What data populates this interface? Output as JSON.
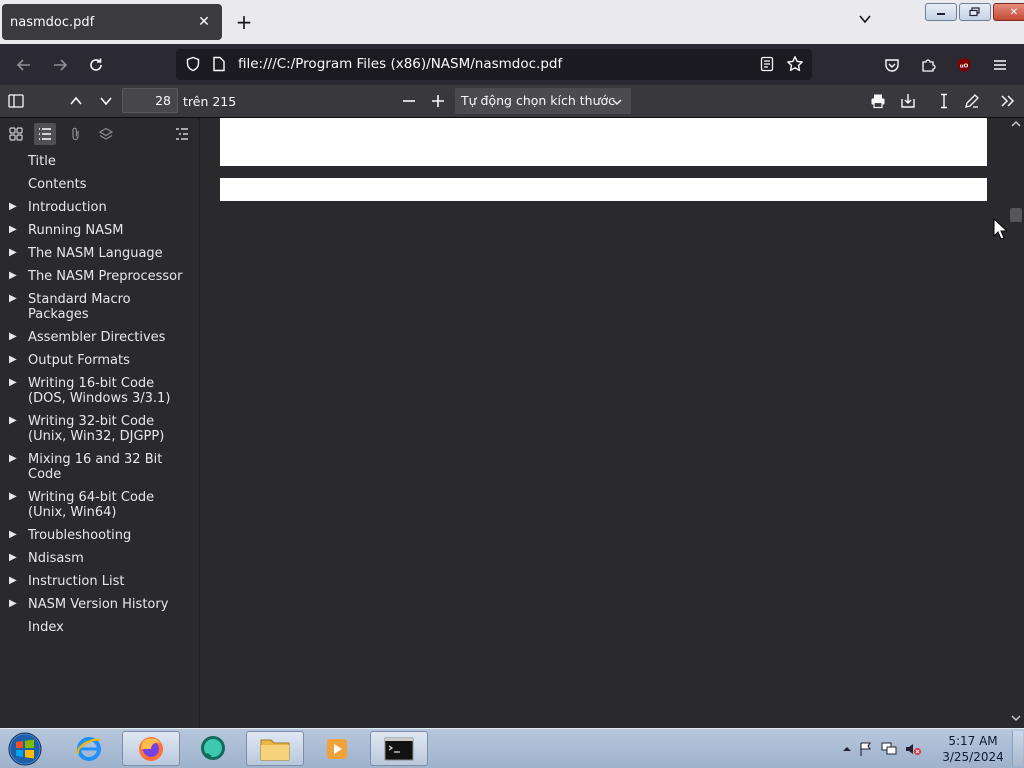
{
  "browser": {
    "tab_title": "nasmdoc.pdf",
    "url": "file:///C:/Program Files (x86)/NASM/nasmdoc.pdf"
  },
  "pdf_toolbar": {
    "current_page": "28",
    "page_count_label": "trên 215",
    "zoom_label": "Tự động chọn kích thước"
  },
  "outline": {
    "items": [
      {
        "label": "Title",
        "expandable": false
      },
      {
        "label": "Contents",
        "expandable": false
      },
      {
        "label": "Introduction",
        "expandable": true
      },
      {
        "label": "Running NASM",
        "expandable": true
      },
      {
        "label": "The NASM Language",
        "expandable": true
      },
      {
        "label": "The NASM Preprocessor",
        "expandable": true
      },
      {
        "label": "Standard Macro Packages",
        "expandable": true
      },
      {
        "label": "Assembler Directives",
        "expandable": true
      },
      {
        "label": "Output Formats",
        "expandable": true
      },
      {
        "label": "Writing 16-bit Code (DOS, Windows 3/3.1)",
        "expandable": true
      },
      {
        "label": "Writing 32-bit Code (Unix, Win32, DJGPP)",
        "expandable": true
      },
      {
        "label": "Mixing 16 and 32 Bit Code",
        "expandable": true
      },
      {
        "label": "Writing 64-bit Code (Unix, Win64)",
        "expandable": true
      },
      {
        "label": "Troubleshooting",
        "expandable": true
      },
      {
        "label": "Ndisasm",
        "expandable": true
      },
      {
        "label": "Instruction List",
        "expandable": true
      },
      {
        "label": "NASM Version History",
        "expandable": true
      },
      {
        "label": "Index",
        "expandable": false
      }
    ]
  },
  "taskbar": {
    "time": "5:17 AM",
    "date": "3/25/2024"
  },
  "colors": {
    "toolbar_bg": "#38383d",
    "sidebar_bg": "#2a2a2e",
    "page_bg": "#ffffff",
    "tab_active": "#3b3b3f"
  }
}
